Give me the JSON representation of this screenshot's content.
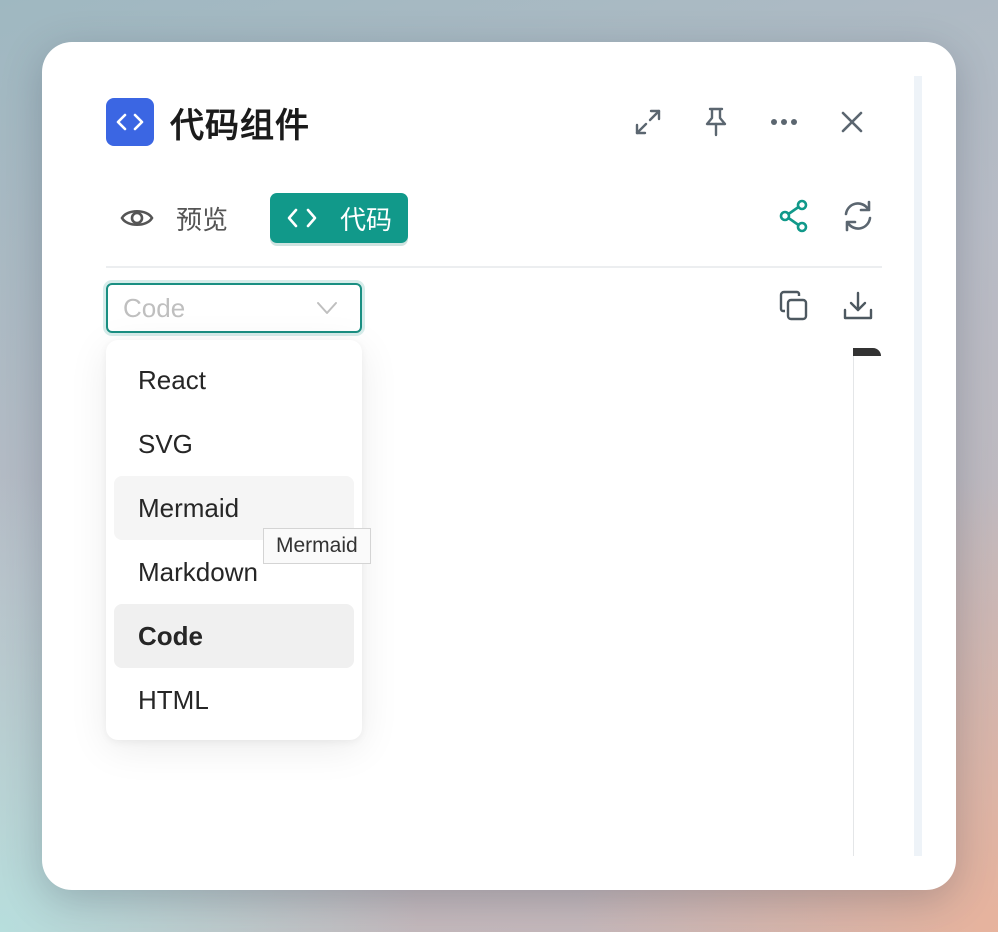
{
  "header": {
    "title": "代码组件",
    "icon": "code-brackets-icon",
    "actions": [
      "expand-icon",
      "pin-icon",
      "more-icon",
      "close-icon"
    ]
  },
  "tabs": {
    "preview_label": "预览",
    "code_label": "代码",
    "active": "code"
  },
  "toolbar": {
    "share_icon": "share-icon",
    "refresh_icon": "refresh-icon",
    "copy_icon": "copy-icon",
    "download_icon": "download-icon"
  },
  "language_select": {
    "placeholder": "Code",
    "options": [
      "React",
      "SVG",
      "Mermaid",
      "Markdown",
      "Code",
      "HTML"
    ],
    "selected": "Code",
    "hovered": "Mermaid"
  },
  "tooltip": {
    "text": "Mermaid"
  },
  "colors": {
    "accent": "#11998a",
    "app_icon_bg": "#3b66e3",
    "select_border": "#1a8f82"
  }
}
